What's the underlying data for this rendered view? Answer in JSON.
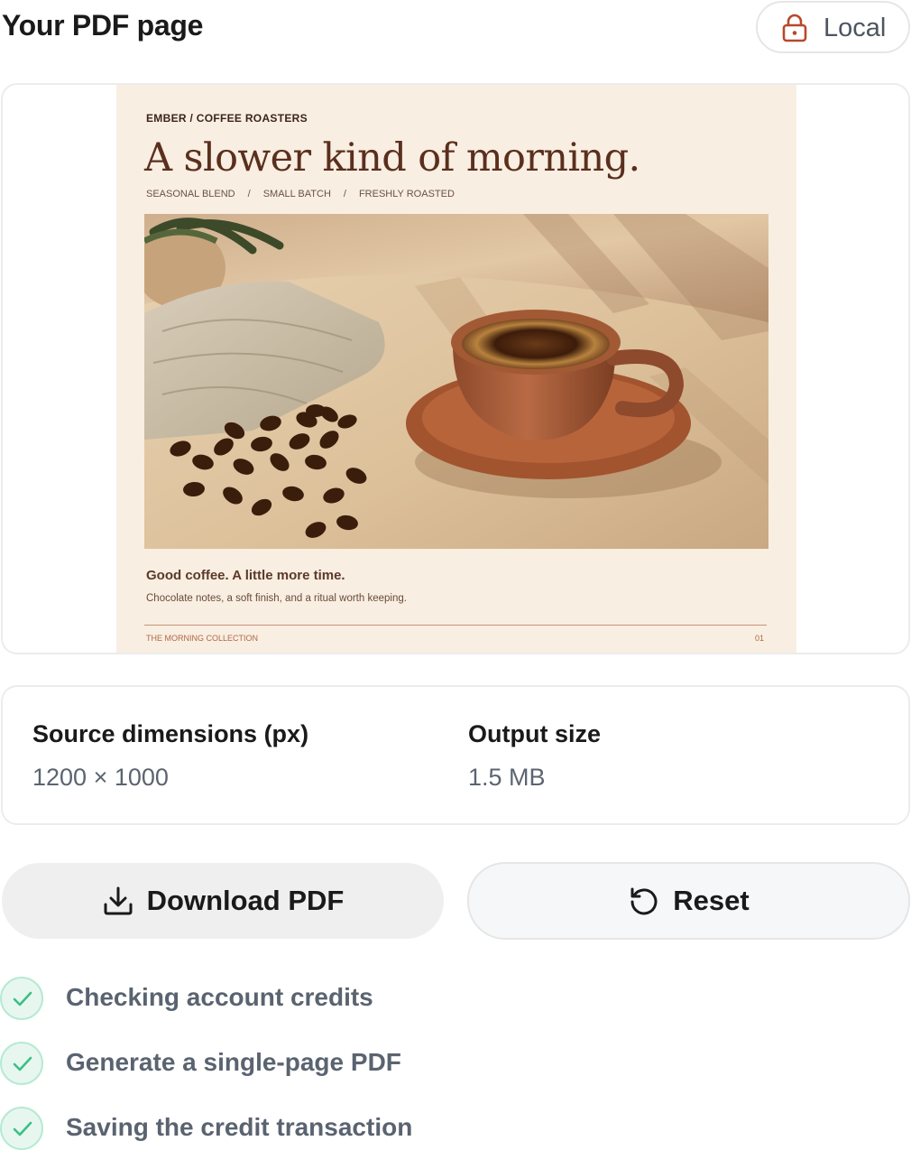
{
  "header": {
    "title": "Your PDF page",
    "badge_label": "Local"
  },
  "pdf": {
    "brand": "EMBER / COFFEE ROASTERS",
    "headline": "A slower kind of morning.",
    "tags": [
      "SEASONAL BLEND",
      "SMALL BATCH",
      "FRESHLY ROASTED"
    ],
    "tag_separator": "/",
    "subhead": "Good coffee. A little more time.",
    "description": "Chocolate notes, a soft finish, and a ritual worth keeping.",
    "footer_left": "THE MORNING COLLECTION",
    "footer_right": "01",
    "photo_description_icon": "coffee-cup-photo"
  },
  "stats": {
    "source_label": "Source dimensions (px)",
    "source_value": "1200 × 1000",
    "output_label": "Output size",
    "output_value": "1.5 MB"
  },
  "actions": {
    "download_label": "Download PDF",
    "reset_label": "Reset"
  },
  "steps": [
    {
      "label": "Checking account credits",
      "status": "done"
    },
    {
      "label": "Generate a single-page PDF",
      "status": "done"
    },
    {
      "label": "Saving the credit transaction",
      "status": "done"
    }
  ],
  "colors": {
    "accent_lock": "#b8482a",
    "check_green": "#3cbf84",
    "pdf_background": "#f8eee1"
  }
}
